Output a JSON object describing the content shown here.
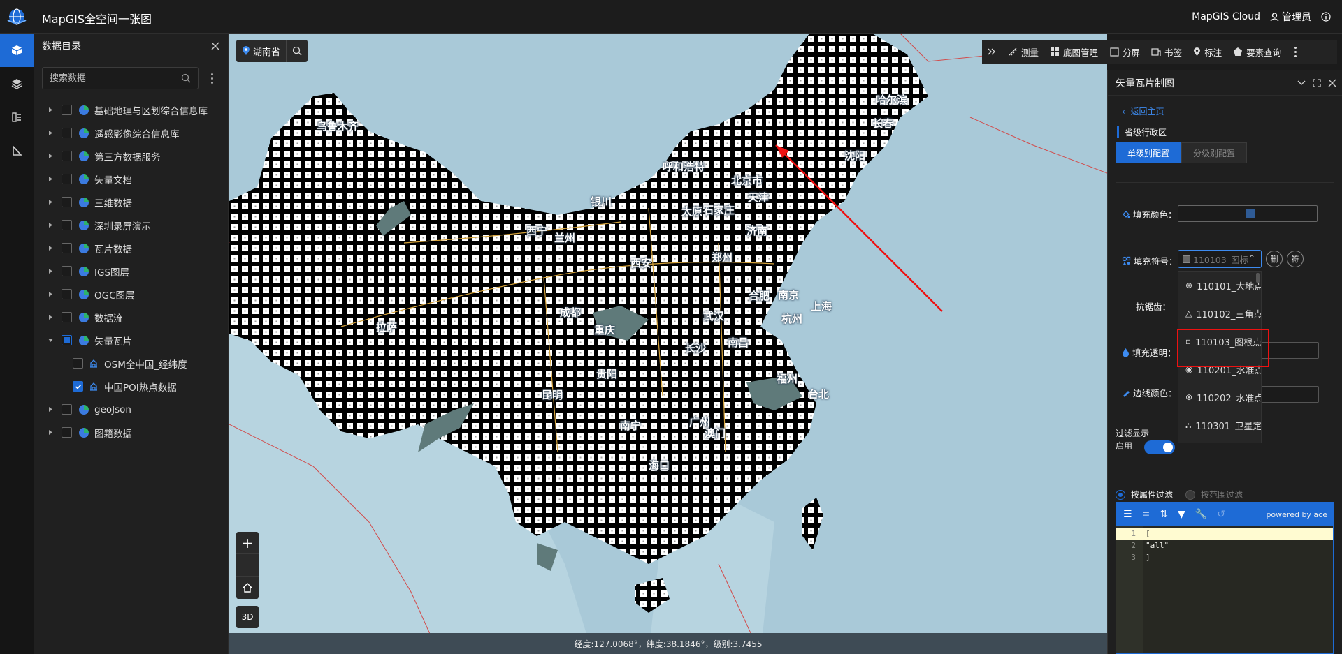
{
  "app": {
    "title": "MapGIS全空间一张图",
    "cloud": "MapGIS Cloud",
    "user": "管理员"
  },
  "catalog": {
    "title": "数据目录",
    "search_placeholder": "搜索数据",
    "items": [
      {
        "label": "基础地理与区划综合信息库",
        "checked": false
      },
      {
        "label": "遥感影像综合信息库",
        "checked": false
      },
      {
        "label": "第三方数据服务",
        "checked": false
      },
      {
        "label": "矢量文档",
        "checked": false
      },
      {
        "label": "三维数据",
        "checked": false
      },
      {
        "label": "深圳录屏演示",
        "checked": false
      },
      {
        "label": "瓦片数据",
        "checked": false
      },
      {
        "label": "IGS图层",
        "checked": false
      },
      {
        "label": "OGC图层",
        "checked": false
      },
      {
        "label": "数据流",
        "checked": false
      },
      {
        "label": "矢量瓦片",
        "expanded": true,
        "partial": true
      },
      {
        "label": "OSM全中国_经纬度",
        "child": true,
        "checked": false
      },
      {
        "label": "中国POI热点数据",
        "child": true,
        "checked": true
      },
      {
        "label": "geoJson",
        "checked": false
      },
      {
        "label": "图籍数据",
        "checked": false
      }
    ]
  },
  "map": {
    "location": "湖南省",
    "labels": [
      "乌鲁木齐",
      "呼和浩特",
      "哈尔滨",
      "长春",
      "沈阳",
      "北京市",
      "天津",
      "石家庄",
      "太原",
      "银川",
      "西宁",
      "兰州",
      "济南",
      "郑州",
      "西安",
      "合肥",
      "南京",
      "上海",
      "武汉",
      "杭州",
      "成都",
      "拉萨",
      "重庆",
      "长沙",
      "南昌",
      "贵阳",
      "福州",
      "台北",
      "昆明",
      "南宁",
      "广州",
      "澳门",
      "海口"
    ],
    "zoom_in": "+",
    "zoom_out": "—",
    "btn_3d": "3D",
    "status": "经度:127.0068°，纬度:38.1846°，级别:3.7455"
  },
  "toolbar": {
    "items": [
      "测量",
      "底图管理",
      "分屏",
      "书签",
      "标注",
      "要素查询"
    ]
  },
  "panel": {
    "title": "矢量瓦片制图",
    "back": "返回主页",
    "section": "省级行政区",
    "tabs": [
      "单级别配置",
      "分级别配置"
    ],
    "fill_color_label": "填充颜色：",
    "fill_color": "#2f5b95",
    "fill_symbol_label": "填充符号：",
    "fill_symbol_value": "110103_图标",
    "btn_delete": "删",
    "btn_symbol": "符",
    "antialias_label": "抗锯齿：",
    "fill_opacity_label": "填充透明：",
    "border_color_label": "边线颜色：",
    "symbol_options": [
      "110101_大地点",
      "110102_三角点",
      "110103_图根点",
      "110201_水准点",
      "110202_水准点",
      "110301_卫星定"
    ],
    "filter_label": "过滤显示",
    "filter_toggle_label": "启用",
    "filter_by_attr": "按属性过滤",
    "filter_by_range": "按范围过滤",
    "editor_powered": "powered by ace",
    "editor_lines": [
      "[",
      "  \"all\"",
      "]"
    ]
  }
}
